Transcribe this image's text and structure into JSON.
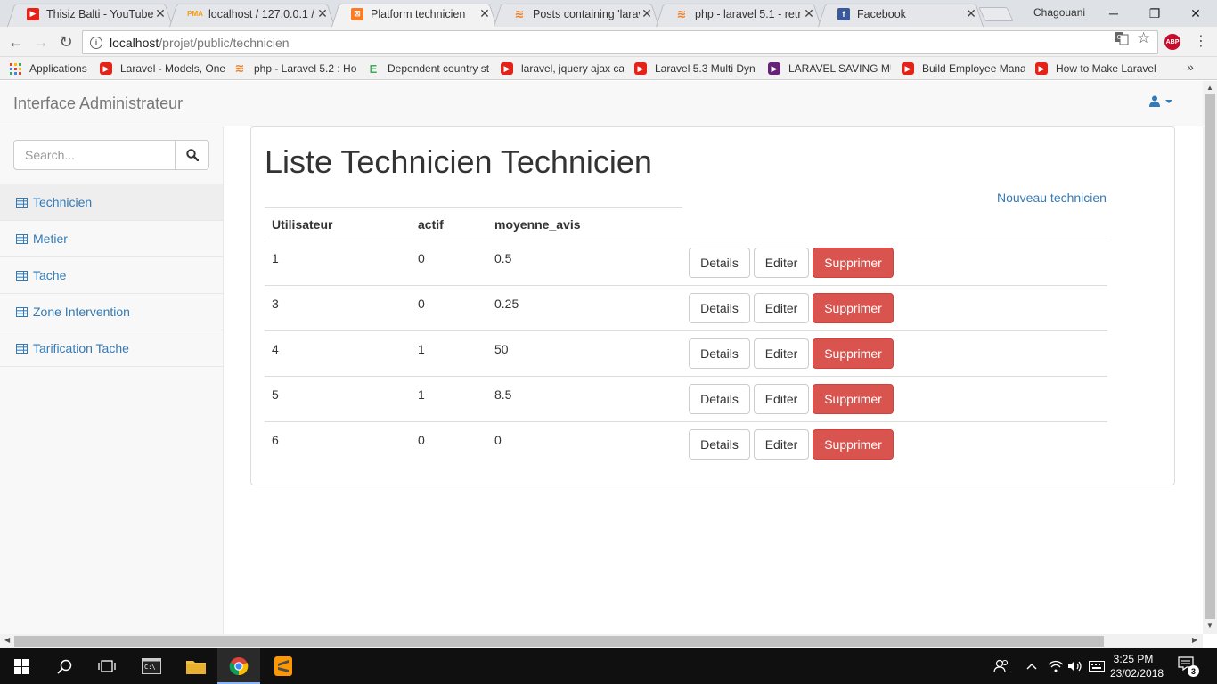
{
  "browser": {
    "tabs": [
      {
        "title": "Thisiz Balti - YouTube",
        "favicon": "youtube-icon"
      },
      {
        "title": "localhost / 127.0.0.1 / p",
        "favicon": "phpmyadmin-icon"
      },
      {
        "title": "Platform technicien",
        "favicon": "xampp-icon"
      },
      {
        "title": "Posts containing 'larav",
        "favicon": "stackoverflow-icon"
      },
      {
        "title": "php - laravel 5.1 - retrie",
        "favicon": "stackoverflow-icon"
      },
      {
        "title": "Facebook",
        "favicon": "facebook-icon"
      }
    ],
    "window_user": "Chagouani",
    "url_host": "localhost",
    "url_path": "/projet/public/technicien",
    "abp_label": "ABP",
    "bookmarks": [
      {
        "label": "Applications",
        "icon": "apps-grid-icon"
      },
      {
        "label": "Laravel - Models, One",
        "icon": "youtube-icon"
      },
      {
        "label": "php - Laravel 5.2 : Ho",
        "icon": "stackoverflow-icon"
      },
      {
        "label": "Dependent country st",
        "icon": "e-icon"
      },
      {
        "label": "laravel, jquery ajax ca",
        "icon": "youtube-icon"
      },
      {
        "label": "Laravel 5.3 Multi Dyn",
        "icon": "youtube-icon"
      },
      {
        "label": "LARAVEL SAVING MU",
        "icon": "visualstudio-icon"
      },
      {
        "label": "Build Employee Mana",
        "icon": "youtube-icon"
      },
      {
        "label": "How to Make Laravel",
        "icon": "youtube-icon"
      }
    ]
  },
  "app": {
    "brand": "Interface Administrateur",
    "search_placeholder": "Search...",
    "sidebar": [
      {
        "label": "Technicien",
        "active": true
      },
      {
        "label": "Metier"
      },
      {
        "label": "Tache"
      },
      {
        "label": "Zone Intervention"
      },
      {
        "label": "Tarification Tache"
      }
    ],
    "page_title": "Liste Technicien Technicien",
    "new_link": "Nouveau technicien",
    "columns": [
      "Utilisateur",
      "actif",
      "moyenne_avis"
    ],
    "rows": [
      {
        "utilisateur": "1",
        "actif": "0",
        "moyenne_avis": "0.5"
      },
      {
        "utilisateur": "3",
        "actif": "0",
        "moyenne_avis": "0.25"
      },
      {
        "utilisateur": "4",
        "actif": "1",
        "moyenne_avis": "50"
      },
      {
        "utilisateur": "5",
        "actif": "1",
        "moyenne_avis": "8.5"
      },
      {
        "utilisateur": "6",
        "actif": "0",
        "moyenne_avis": "0"
      }
    ],
    "actions": {
      "details": "Details",
      "edit": "Editer",
      "delete": "Supprimer"
    }
  },
  "taskbar": {
    "time": "3:25 PM",
    "date": "23/02/2018",
    "notification_count": "3"
  },
  "colors": {
    "link": "#337ab7",
    "danger": "#d9534f",
    "navbar_bg": "#f8f8f8"
  }
}
